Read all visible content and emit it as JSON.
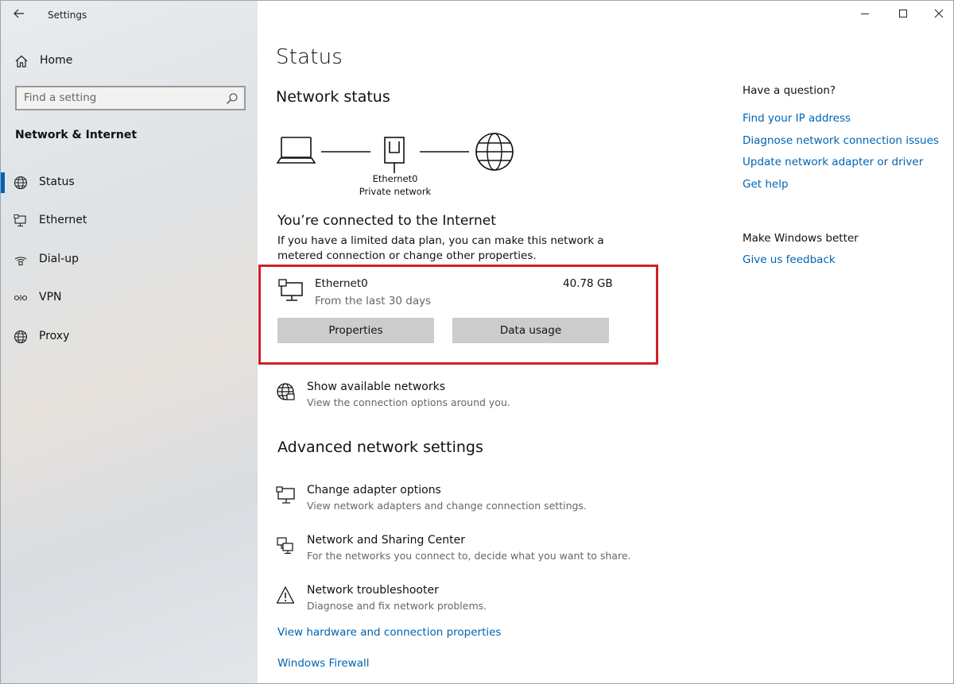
{
  "window": {
    "title": "Settings"
  },
  "sidebar": {
    "home_label": "Home",
    "search_placeholder": "Find a setting",
    "section_title": "Network & Internet",
    "items": [
      {
        "label": "Status",
        "icon": "globe-icon",
        "selected": true
      },
      {
        "label": "Ethernet",
        "icon": "ethernet-icon",
        "selected": false
      },
      {
        "label": "Dial-up",
        "icon": "dialup-icon",
        "selected": false
      },
      {
        "label": "VPN",
        "icon": "vpn-icon",
        "selected": false
      },
      {
        "label": "Proxy",
        "icon": "globe-icon",
        "selected": false
      }
    ]
  },
  "main": {
    "title": "Status",
    "network_status_heading": "Network status",
    "diagram": {
      "adapter_name": "Ethernet0",
      "network_type": "Private network"
    },
    "connected_heading": "You’re connected to the Internet",
    "connected_desc": "If you have a limited data plan, you can make this network a metered connection or change other properties.",
    "connection": {
      "name": "Ethernet0",
      "sub": "From the last 30 days",
      "usage": "40.78 GB",
      "properties_button": "Properties",
      "data_usage_button": "Data usage"
    },
    "show_networks": {
      "title": "Show available networks",
      "sub": "View the connection options around you."
    },
    "advanced_heading": "Advanced network settings",
    "advanced_items": [
      {
        "title": "Change adapter options",
        "sub": "View network adapters and change connection settings.",
        "icon": "adapter-icon"
      },
      {
        "title": "Network and Sharing Center",
        "sub": "For the networks you connect to, decide what you want to share.",
        "icon": "sharing-center-icon"
      },
      {
        "title": "Network troubleshooter",
        "sub": "Diagnose and fix network problems.",
        "icon": "warning-icon"
      }
    ],
    "links": [
      "View hardware and connection properties",
      "Windows Firewall"
    ]
  },
  "right_panel": {
    "question_heading": "Have a question?",
    "question_links": [
      "Find your IP address",
      "Diagnose network connection issues",
      "Update network adapter or driver",
      "Get help"
    ],
    "better_heading": "Make Windows better",
    "feedback_link": "Give us feedback"
  },
  "colors": {
    "accent": "#0063b1",
    "highlight_border": "#d21f26",
    "button_bg": "#cccccc"
  }
}
